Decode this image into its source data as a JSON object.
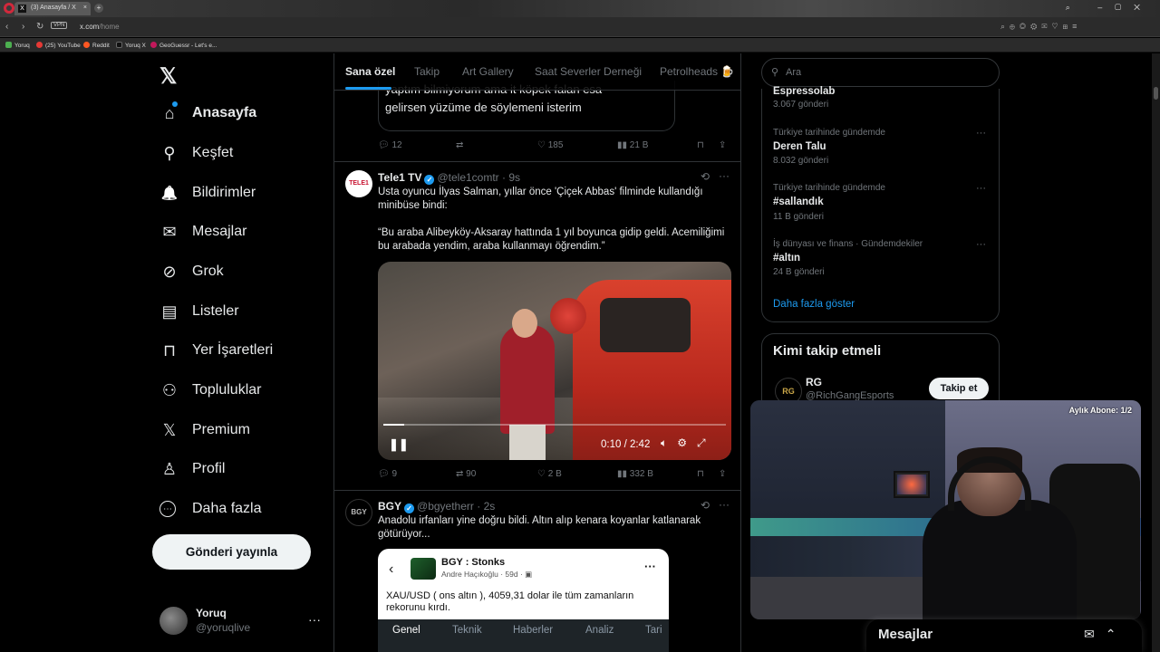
{
  "browser": {
    "tab_title": "(3) Anasayfa / X",
    "url_domain": "x.com",
    "url_path": "/home",
    "vpn_label": "VPN",
    "bookmarks": [
      {
        "label": "Yoruq",
        "color": "#4caf50"
      },
      {
        "label": "(25) YouTube",
        "color": "#e53935"
      },
      {
        "label": "Reddit",
        "color": "#ff5722"
      },
      {
        "label": "Yoruq X",
        "color": "#222222"
      },
      {
        "label": "GeoGuessr - Let's e...",
        "color": "#c2185b"
      }
    ]
  },
  "sidebar": {
    "logo": "𝕏",
    "items": [
      {
        "label": "Anasayfa",
        "icon": "home-icon",
        "glyph": "⌂"
      },
      {
        "label": "Keşfet",
        "icon": "search-icon",
        "glyph": "⚲"
      },
      {
        "label": "Bildirimler",
        "icon": "bell-icon",
        "glyph": "🔔"
      },
      {
        "label": "Mesajlar",
        "icon": "envelope-icon",
        "glyph": "✉"
      },
      {
        "label": "Grok",
        "icon": "grok-icon",
        "glyph": "⊘"
      },
      {
        "label": "Listeler",
        "icon": "list-icon",
        "glyph": "▤"
      },
      {
        "label": "Yer İşaretleri",
        "icon": "bookmark-icon",
        "glyph": "⊓"
      },
      {
        "label": "Topluluklar",
        "icon": "communities-icon",
        "glyph": "⚇"
      },
      {
        "label": "Premium",
        "icon": "x-premium-icon",
        "glyph": "𝕏"
      },
      {
        "label": "Profil",
        "icon": "profile-icon",
        "glyph": "♙"
      },
      {
        "label": "Daha fazla",
        "icon": "more-circle-icon",
        "glyph": "⋯"
      }
    ],
    "post_button": "Gönderi yayınla",
    "account": {
      "name": "Yoruq",
      "handle": "@yoruqlive",
      "more": "···"
    }
  },
  "feed": {
    "tabs": [
      "Sana özel",
      "Takip",
      "Art Gallery",
      "Saat Severler Derneği",
      "Petrolheads 🍺"
    ],
    "active_tab": "Sana özel",
    "post0": {
      "quote_text": "yaptım bilmiyorum ama it köpek falan esa\ngelirsen yüzüme de söylemeni isterim",
      "replies": "12",
      "likes": "185",
      "views": "21 B"
    },
    "post1": {
      "name": "Tele1 TV",
      "handle": "@tele1comtr",
      "time": "· 9s",
      "avatar_text": "TELE1",
      "text": "Usta oyuncu İlyas Salman, yıllar önce 'Çiçek Abbas' filminde kullandığı\nminibüse bindi:\n\n“Bu araba Alibeyköy-Aksaray hattında 1 yıl boyunca gidip geldi. Acemiliğimi\nbu arabada yendim, araba kullanmayı öğrendim.”",
      "video_time": "0:10 / 2:42",
      "video_progress": 0.062,
      "replies": "9",
      "reposts": "90",
      "likes": "2 B",
      "views": "332 B"
    },
    "post2": {
      "name": "BGY",
      "handle": "@bgyetherr",
      "time": "· 2s",
      "avatar_text": "BGY",
      "text": "Anadolu irfanları yine doğru bildi. Altın alıp kenara koyanlar katlanarak\ngötürüyor...",
      "card": {
        "name": "BGY : Stonks",
        "meta": "Andre Haçıkoğlu · 59d · ▣",
        "text": "XAU/USD ( ons altın ), 4059,31 dolar ile tüm zamanların rekorunu kırdı.",
        "tabs": [
          "Genel",
          "Teknik",
          "Haberler",
          "Analiz",
          "Tari"
        ]
      }
    }
  },
  "right": {
    "search_placeholder": "Ara",
    "trends": [
      {
        "context": "",
        "name": "Espressolab",
        "count": "3.067 gönderi"
      },
      {
        "context": "Türkiye tarihinde gündemde",
        "name": "Deren Talu",
        "count": "8.032 gönderi"
      },
      {
        "context": "Türkiye tarihinde gündemde",
        "name": "#sallandık",
        "count": "11 B gönderi"
      },
      {
        "context": "İş dünyası ve finans · Gündemdekiler",
        "name": "#altın",
        "count": "24 B gönderi"
      }
    ],
    "show_more": "Daha fazla göster",
    "who_to_follow": {
      "title": "Kimi takip etmeli",
      "user": {
        "name": "RG",
        "handle": "@RichGangEsports",
        "avatar_text": "RG",
        "button": "Takip et"
      }
    }
  },
  "overlay": {
    "cam_label": "Aylık Abone: 1/2",
    "messages_dock": "Mesajlar"
  },
  "colors": {
    "accent": "#1d9bf0",
    "bg": "#000000",
    "text": "#e7e9ea",
    "muted": "#71767b",
    "border": "#2f3336"
  }
}
